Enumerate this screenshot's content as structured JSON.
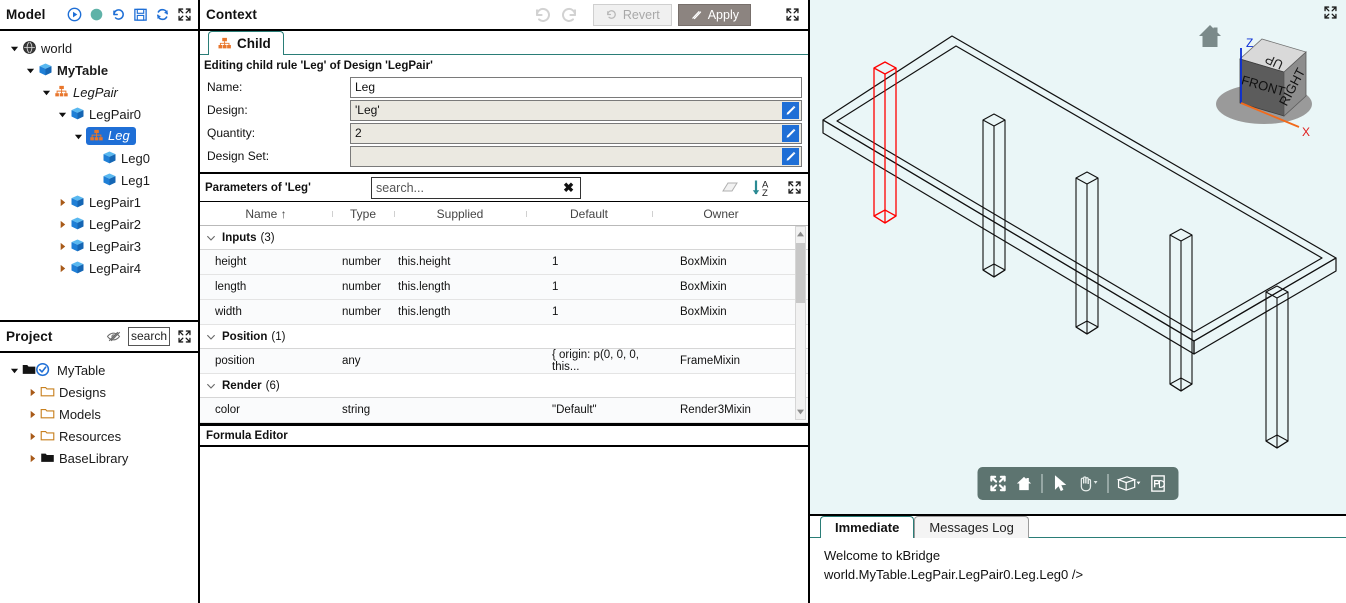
{
  "model_panel": {
    "title": "Model",
    "toolbar": [
      {
        "name": "run-icon",
        "glyph": "play-circle"
      },
      {
        "name": "status-indicator-icon",
        "glyph": "dot"
      },
      {
        "name": "history-icon",
        "glyph": "undo-clock"
      },
      {
        "name": "save-icon",
        "glyph": "floppy"
      },
      {
        "name": "refresh-icon",
        "glyph": "refresh"
      },
      {
        "name": "expand-icon",
        "glyph": "expand"
      }
    ],
    "tree": [
      {
        "label": "world",
        "depth": 0,
        "twisty": "down",
        "icon": "globe",
        "bold": false,
        "italic": false,
        "selected": false
      },
      {
        "label": "MyTable",
        "depth": 1,
        "twisty": "down",
        "icon": "cube",
        "bold": true,
        "italic": false,
        "selected": false
      },
      {
        "label": "LegPair",
        "depth": 2,
        "twisty": "down",
        "icon": "rule",
        "bold": false,
        "italic": true,
        "selected": false
      },
      {
        "label": "LegPair0",
        "depth": 3,
        "twisty": "down",
        "icon": "cube",
        "bold": false,
        "italic": false,
        "selected": false
      },
      {
        "label": "Leg",
        "depth": 4,
        "twisty": "down",
        "icon": "rule",
        "bold": false,
        "italic": true,
        "selected": true
      },
      {
        "label": "Leg0",
        "depth": 5,
        "twisty": "none",
        "icon": "cube",
        "bold": false,
        "italic": false,
        "selected": false
      },
      {
        "label": "Leg1",
        "depth": 5,
        "twisty": "none",
        "icon": "cube",
        "bold": false,
        "italic": false,
        "selected": false
      },
      {
        "label": "LegPair1",
        "depth": 3,
        "twisty": "right",
        "icon": "cube",
        "bold": false,
        "italic": false,
        "selected": false
      },
      {
        "label": "LegPair2",
        "depth": 3,
        "twisty": "right",
        "icon": "cube",
        "bold": false,
        "italic": false,
        "selected": false
      },
      {
        "label": "LegPair3",
        "depth": 3,
        "twisty": "right",
        "icon": "cube",
        "bold": false,
        "italic": false,
        "selected": false
      },
      {
        "label": "LegPair4",
        "depth": 3,
        "twisty": "right",
        "icon": "cube",
        "bold": false,
        "italic": false,
        "selected": false
      }
    ]
  },
  "project_panel": {
    "title": "Project",
    "search_value": "search",
    "search_placeholder": "search",
    "tree": [
      {
        "label": "MyTable",
        "depth": 0,
        "twisty": "down",
        "icon": "folder-open-check"
      },
      {
        "label": "Designs",
        "depth": 1,
        "twisty": "right",
        "icon": "folder"
      },
      {
        "label": "Models",
        "depth": 1,
        "twisty": "right",
        "icon": "folder"
      },
      {
        "label": "Resources",
        "depth": 1,
        "twisty": "right",
        "icon": "folder"
      },
      {
        "label": "BaseLibrary",
        "depth": 1,
        "twisty": "right",
        "icon": "folder-filled"
      }
    ]
  },
  "context": {
    "title": "Context",
    "undo_label": "undo",
    "redo_label": "redo",
    "revert_label": "Revert",
    "apply_label": "Apply",
    "tabs": [
      {
        "label": "Child",
        "active": true
      }
    ],
    "subtitle": "Editing child rule 'Leg' of Design 'LegPair'",
    "fields": [
      {
        "label": "Name:",
        "value": "Leg",
        "editable_icon": false,
        "white": true
      },
      {
        "label": "Design:",
        "value": "'Leg'",
        "editable_icon": true,
        "white": false
      },
      {
        "label": "Quantity:",
        "value": "2",
        "editable_icon": true,
        "white": false
      },
      {
        "label": "Design Set:",
        "value": "",
        "editable_icon": true,
        "white": false
      }
    ]
  },
  "parameters": {
    "title": "Parameters of 'Leg'",
    "search_placeholder": "search...",
    "search_value": "",
    "clear_label": "✖",
    "columns": [
      "Name ↑",
      "Type",
      "Supplied",
      "Default",
      "Owner"
    ],
    "groups": [
      {
        "label": "Inputs",
        "count": "(3)",
        "expanded": true,
        "rows": [
          {
            "name": "height",
            "type": "number",
            "supplied": "this.height",
            "default": "1",
            "owner": "BoxMixin"
          },
          {
            "name": "length",
            "type": "number",
            "supplied": "this.length",
            "default": "1",
            "owner": "BoxMixin"
          },
          {
            "name": "width",
            "type": "number",
            "supplied": "this.length",
            "default": "1",
            "owner": "BoxMixin"
          }
        ]
      },
      {
        "label": "Position",
        "count": "(1)",
        "expanded": true,
        "rows": [
          {
            "name": "position",
            "type": "any",
            "supplied": "",
            "default": "{ origin: p(0, 0, 0, this...",
            "owner": "FrameMixin"
          }
        ]
      },
      {
        "label": "Render",
        "count": "(6)",
        "expanded": true,
        "rows": [
          {
            "name": "color",
            "type": "string",
            "supplied": "",
            "default": "\"Default\"",
            "owner": "Render3Mixin"
          }
        ]
      }
    ]
  },
  "formula_editor": {
    "title": "Formula Editor",
    "content": ""
  },
  "viewport": {
    "background": "#eaf6f7",
    "highlight_color": "#ff0000",
    "view_cube": {
      "face_top": "UP",
      "face_front": "FRONT",
      "face_right": "RIGHT",
      "axis_z": "Z",
      "axis_x": "X"
    },
    "toolbar": [
      {
        "name": "fit-to-view-icon",
        "glyph": "fit"
      },
      {
        "name": "home-view-icon",
        "glyph": "home"
      },
      {
        "name": "select-tool-icon",
        "glyph": "cursor"
      },
      {
        "name": "pan-tool-icon",
        "glyph": "hand"
      },
      {
        "name": "view-style-icon",
        "glyph": "box"
      },
      {
        "name": "export-pdf-icon",
        "glyph": "pdf"
      }
    ]
  },
  "console": {
    "tabs": [
      {
        "label": "Immediate",
        "active": true
      },
      {
        "label": "Messages Log",
        "active": false
      }
    ],
    "lines": [
      "Welcome to kBridge",
      "world.MyTable.LegPair.LegPair0.Leg.Leg0 />"
    ]
  }
}
